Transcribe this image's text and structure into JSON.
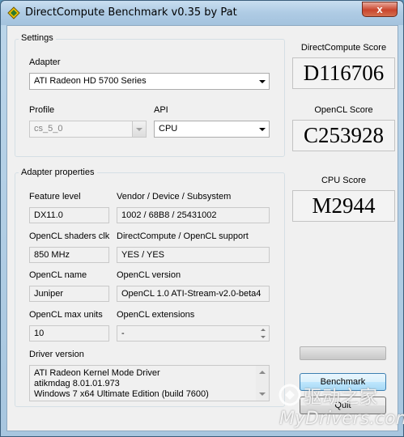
{
  "window": {
    "title": "DirectCompute Benchmark v0.35 by Pat",
    "close_label": "x"
  },
  "settings": {
    "group_label": "Settings",
    "adapter_label": "Adapter",
    "adapter_value": "ATI Radeon HD 5700 Series",
    "profile_label": "Profile",
    "profile_value": "cs_5_0",
    "api_label": "API",
    "api_value": "CPU"
  },
  "adapter_properties": {
    "group_label": "Adapter properties",
    "feature_level_label": "Feature level",
    "feature_level_value": "DX11.0",
    "vendor_label": "Vendor / Device / Subsystem",
    "vendor_value": "1002 / 68B8 / 25431002",
    "shaders_clk_label": "OpenCL shaders clk",
    "shaders_clk_value": "850 MHz",
    "support_label": "DirectCompute / OpenCL support",
    "support_value": "YES / YES",
    "opencl_name_label": "OpenCL name",
    "opencl_name_value": "Juniper",
    "opencl_version_label": "OpenCL version",
    "opencl_version_value": "OpenCL 1.0 ATI-Stream-v2.0-beta4",
    "max_units_label": "OpenCL max units",
    "max_units_value": "10",
    "extensions_label": "OpenCL extensions",
    "extensions_value": "-",
    "driver_label": "Driver version",
    "driver_lines": [
      "ATI Radeon Kernel Mode Driver",
      "atikmdag 8.01.01.973",
      "Windows 7 x64 Ultimate Edition (build 7600)"
    ]
  },
  "scores": {
    "directcompute_label": "DirectCompute Score",
    "directcompute_value": "D116706",
    "opencl_label": "OpenCL Score",
    "opencl_value": "C253928",
    "cpu_label": "CPU Score",
    "cpu_value": "M2944"
  },
  "actions": {
    "progress": 0,
    "benchmark_label": "Benchmark",
    "quit_label": "Quit"
  },
  "watermark": {
    "cn_text": "驱动之家",
    "en_text": "MyDrivers.com"
  }
}
